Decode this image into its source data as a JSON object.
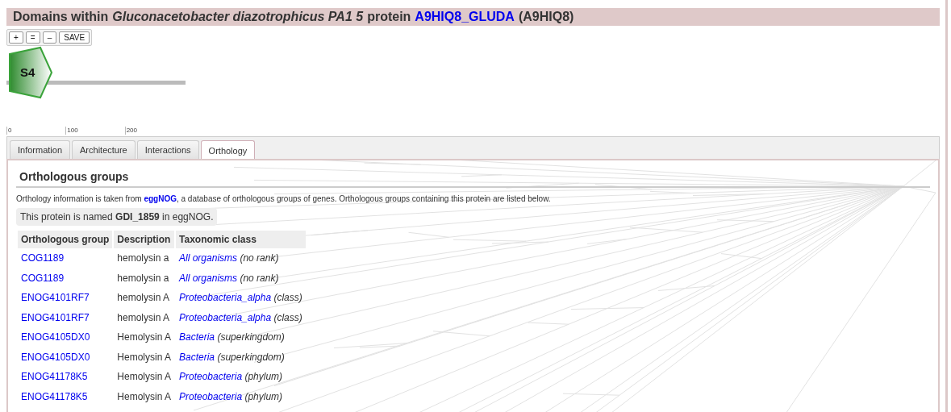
{
  "title": [
    {
      "kind": "text",
      "text": "Domains within"
    },
    {
      "kind": "italic",
      "text": "Gluconacetobacter diazotrophicus PA1 5"
    },
    {
      "kind": "text",
      "text": "protein"
    },
    {
      "kind": "link",
      "text": "A9HIQ8_GLUDA"
    },
    {
      "kind": "text",
      "text": "(A9HIQ8)"
    }
  ],
  "zoom_buttons": [
    "+",
    "=",
    "–",
    "SAVE"
  ],
  "domain": {
    "label": "S4"
  },
  "scale": {
    "ticks": [
      "0",
      "100",
      "200"
    ]
  },
  "tabs": [
    {
      "label": "Information",
      "selected": false
    },
    {
      "label": "Architecture",
      "selected": false
    },
    {
      "label": "Interactions",
      "selected": false
    },
    {
      "label": "Orthology",
      "selected": true
    }
  ],
  "section_title": "Orthologous groups",
  "intro": {
    "before": "Orthology information is taken from ",
    "link": "eggNOG",
    "after": ", a database of orthologous groups of genes. Orthologous groups containing this protein are listed below."
  },
  "note": "This protein is named **GDI_1859** in eggNOG.",
  "table": {
    "columns": [
      "Orthologous group",
      "Description",
      "Taxonomic class"
    ],
    "rows": [
      {
        "group": "COG1189",
        "description": "hemolysin a",
        "taxon": "All organisms",
        "rank": "(no rank)"
      },
      {
        "group": "COG1189",
        "description": "hemolysin a",
        "taxon": "All organisms",
        "rank": "(no rank)"
      },
      {
        "group": "ENOG4101RF7",
        "description": "hemolysin A",
        "taxon": "Proteobacteria_alpha",
        "rank": "(class)"
      },
      {
        "group": "ENOG4101RF7",
        "description": "hemolysin A",
        "taxon": "Proteobacteria_alpha",
        "rank": "(class)"
      },
      {
        "group": "ENOG4105DX0",
        "description": "Hemolysin A",
        "taxon": "Bacteria",
        "rank": "(superkingdom)"
      },
      {
        "group": "ENOG4105DX0",
        "description": "Hemolysin A",
        "taxon": "Bacteria",
        "rank": "(superkingdom)"
      },
      {
        "group": "ENOG41178K5",
        "description": "Hemolysin A",
        "taxon": "Proteobacteria",
        "rank": "(phylum)"
      },
      {
        "group": "ENOG41178K5",
        "description": "Hemolysin A",
        "taxon": "Proteobacteria",
        "rank": "(phylum)"
      }
    ]
  }
}
